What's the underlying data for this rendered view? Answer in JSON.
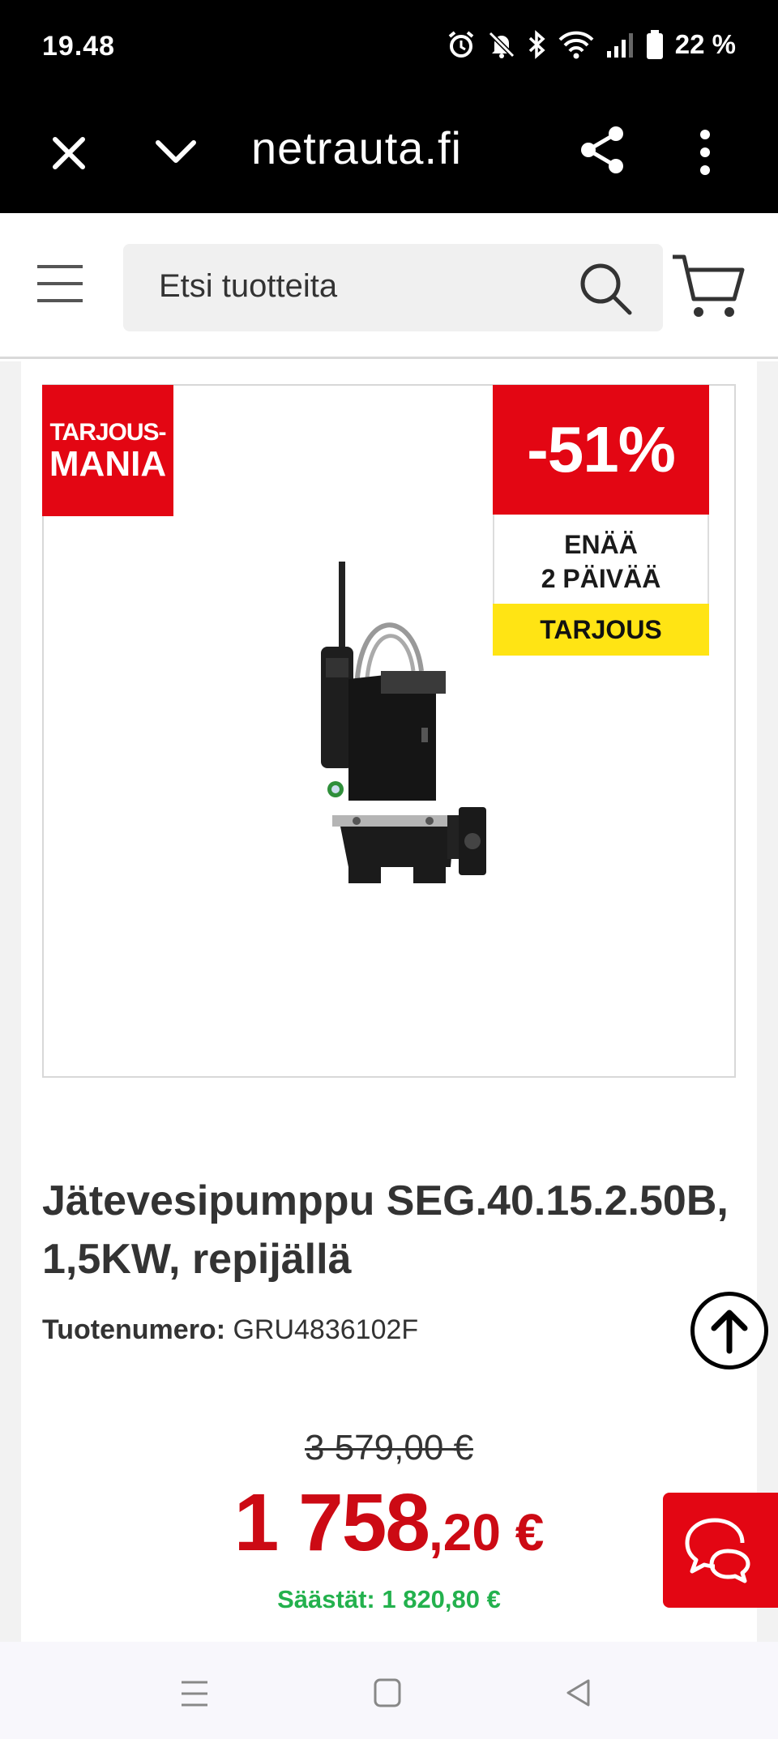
{
  "status_bar": {
    "time": "19.48",
    "battery": "22 %",
    "icons": [
      "alarm-icon",
      "mute-icon",
      "bluetooth-icon",
      "wifi-icon",
      "signal-icon",
      "battery-icon"
    ]
  },
  "browser": {
    "url": "netrauta.fi",
    "icons": [
      "close-icon",
      "chevron-down-icon",
      "share-icon",
      "more-icon"
    ]
  },
  "header": {
    "search_placeholder": "Etsi tuotteita",
    "icons": [
      "menu-icon",
      "search-icon",
      "cart-icon"
    ]
  },
  "product": {
    "badge_campaign_line1": "TARJOUS-",
    "badge_campaign_line2": "MANIA",
    "discount": "-51%",
    "days_line1": "ENÄÄ",
    "days_line2": "2 PÄIVÄÄ",
    "offer_label": "TARJOUS",
    "title": "Jätevesipumppu SEG.40.15.2.50B, 1,5KW, repijällä",
    "sku_label": "Tuotenumero:",
    "sku_value": "GRU4836102F",
    "old_price": "3 579,00 €",
    "price_main": "1 758",
    "price_cents": ",20 €",
    "savings": "Säästät: 1 820,80 €"
  },
  "colors": {
    "brand_red": "#e30613",
    "price_red": "#cc0a14",
    "offer_yellow": "#ffe414",
    "savings_green": "#23b14d"
  }
}
